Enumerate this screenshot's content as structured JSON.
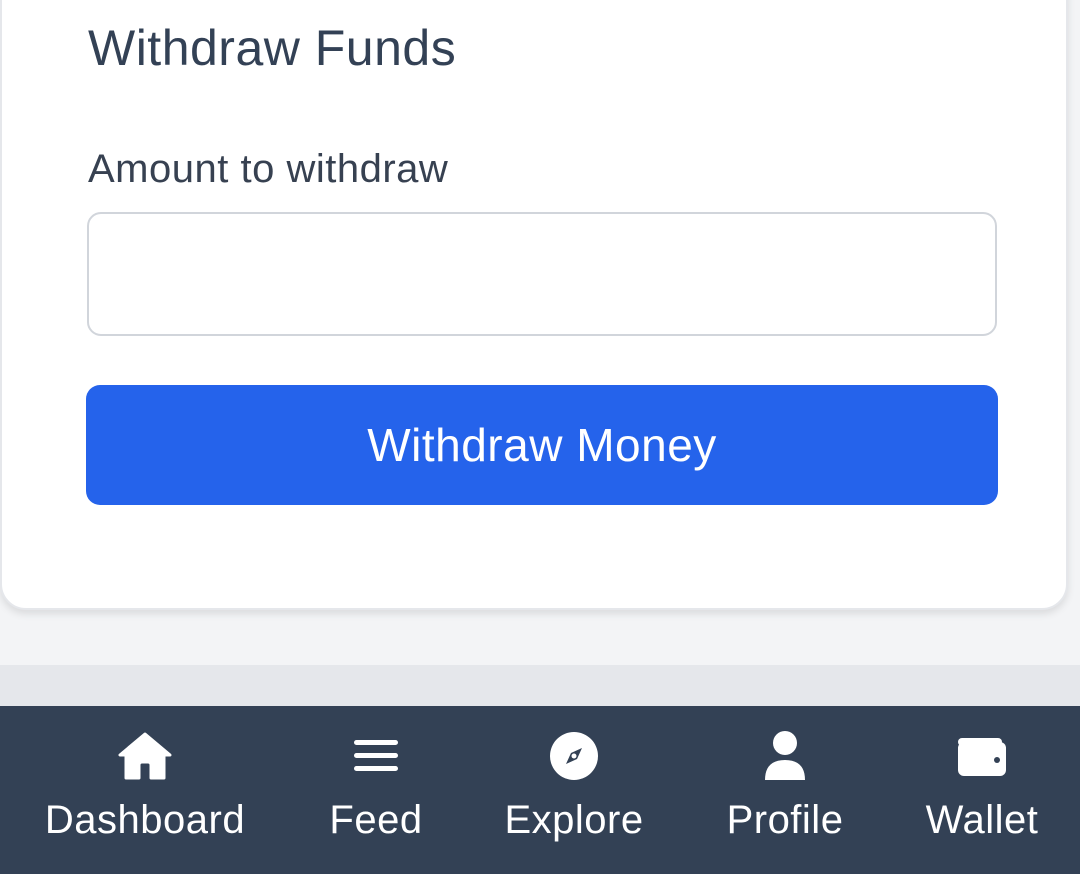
{
  "form": {
    "title": "Withdraw Funds",
    "amount_label": "Amount to withdraw",
    "amount_value": "",
    "submit_label": "Withdraw Money"
  },
  "nav": {
    "items": [
      {
        "label": "Dashboard",
        "icon": "home-icon"
      },
      {
        "label": "Feed",
        "icon": "menu-icon"
      },
      {
        "label": "Explore",
        "icon": "compass-icon"
      },
      {
        "label": "Profile",
        "icon": "user-icon"
      },
      {
        "label": "Wallet",
        "icon": "wallet-icon"
      }
    ]
  },
  "colors": {
    "primary": "#2563eb",
    "nav_background": "#334155",
    "title_text": "#334155"
  }
}
